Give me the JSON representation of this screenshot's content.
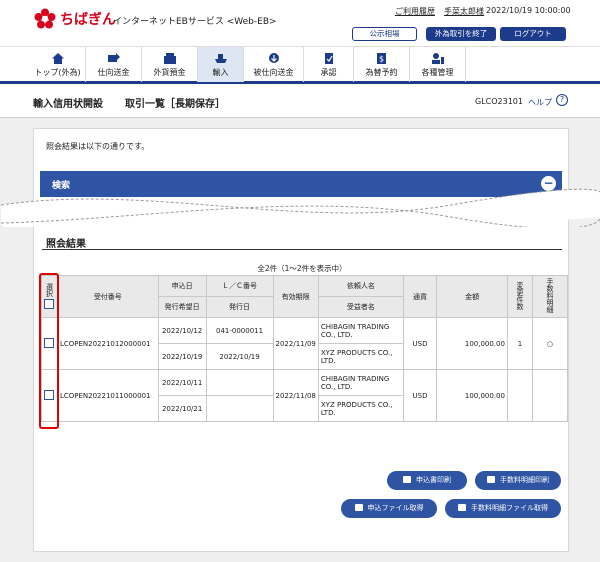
{
  "brand": {
    "logo_text": "ちばぎん",
    "service_name": "インターネットEBサービス <Web-EB>",
    "accent_color": "#d6001c",
    "primary_color": "#1d3b8b"
  },
  "header": {
    "history_link": "ご利用履歴",
    "user_name": "手菜太郎様",
    "datetime": "2022/10/19 10:00:00",
    "market_button": "公示相場",
    "end_fx_button": "外為取引を終了",
    "logout_button": "ログアウト"
  },
  "nav": {
    "items": [
      {
        "label": "トップ(外為)",
        "icon": "home-icon"
      },
      {
        "label": "仕向送金",
        "icon": "outward-remittance-icon"
      },
      {
        "label": "外貨預金",
        "icon": "fx-deposit-icon"
      },
      {
        "label": "輸入",
        "icon": "import-icon"
      },
      {
        "label": "被仕向送金",
        "icon": "inward-remittance-icon"
      },
      {
        "label": "承認",
        "icon": "approval-icon"
      },
      {
        "label": "為替予約",
        "icon": "fx-contract-icon"
      },
      {
        "label": "各種管理",
        "icon": "management-icon"
      }
    ]
  },
  "page": {
    "title_main": "輸入信用状開設",
    "title_sub": "取引一覧［長期保存］",
    "screen_id": "GLCO23101",
    "help_label": "ヘルプ",
    "help_icon_glyph": "?"
  },
  "main": {
    "message": "照会結果は以下の通りです。",
    "search_label": "検索",
    "search_toggle_glyph": "−",
    "results_title": "照会結果",
    "result_count": "全2件（1～2件を表示中）"
  },
  "table": {
    "headers": {
      "select": "選択",
      "receipt_no": "受付番号",
      "apply_date": "申込日",
      "lc_no": "Ｌ／Ｃ番号",
      "expiry": "有効期限",
      "applicant": "依頼人名",
      "currency": "通貨",
      "amount": "金額",
      "change_count": "変更件数",
      "fee_detail": "手数料明細",
      "desired_issue_date": "発行希望日",
      "issue_date": "発行日",
      "beneficiary": "受益者名"
    },
    "rows": [
      {
        "receipt_no": "LCOPEN20221012000001",
        "apply_date": "2022/10/12",
        "desired_issue_date": "2022/10/19",
        "lc_no": "041-0000011",
        "issue_date": "2022/10/19",
        "expiry": "2022/11/09",
        "applicant": "CHIBAGIN TRADING CO., LTD.",
        "beneficiary": "XYZ PRODUCTS CO., LTD.",
        "currency": "USD",
        "amount": "100,000.00",
        "change_count": "1",
        "fee_detail": "○"
      },
      {
        "receipt_no": "LCOPEN20221011000001",
        "apply_date": "2022/10/11",
        "desired_issue_date": "2022/10/21",
        "lc_no": "",
        "issue_date": "",
        "expiry": "2022/11/08",
        "applicant": "CHIBAGIN TRADING CO., LTD.",
        "beneficiary": "XYZ PRODUCTS CO., LTD.",
        "currency": "USD",
        "amount": "100,000.00",
        "change_count": "",
        "fee_detail": ""
      }
    ]
  },
  "actions": {
    "print_application": "申込書印刷",
    "print_fee_detail": "手数料明細印刷",
    "get_application_file": "申込ファイル取得",
    "get_fee_detail_file": "手数料明細ファイル取得"
  },
  "highlight_color": "#e00000"
}
